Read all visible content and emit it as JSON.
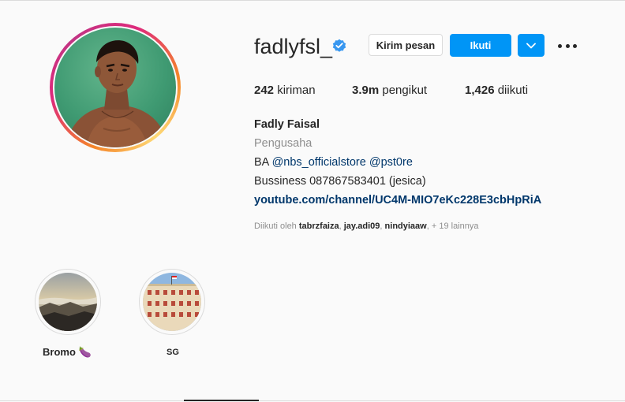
{
  "profile": {
    "username": "fadlyfsl_",
    "message_button": "Kirim pesan",
    "follow_button": "Ikuti",
    "stats": {
      "posts_value": "242",
      "posts_label": "kiriman",
      "followers_value": "3.9m",
      "followers_label": "pengikut",
      "following_value": "1,426",
      "following_label": "diikuti"
    },
    "full_name": "Fadly Faisal",
    "category": "Pengusaha",
    "bio_ba": "BA",
    "bio_mention_1": "@nbs_officialstore",
    "bio_mention_2": "@pst0re",
    "bio_line2": "Bussiness 087867583401 (jesica)",
    "link": "youtube.com/channel/UC4M-MIO7eKc228E3cbHpRiA",
    "followed_by_prefix": "Diikuti oleh",
    "followed_by_users": [
      "tabrzfaiza",
      "jay.adi09",
      "nindyiaaw"
    ],
    "followed_by_suffix": "+ 19 lainnya"
  },
  "highlights": [
    {
      "label": "Bromo",
      "emoji": "🍆"
    },
    {
      "label": "SG"
    }
  ],
  "colors": {
    "accent": "#0095f6",
    "link": "#00376b",
    "muted": "#8e8e8e",
    "text": "#262626",
    "background": "#fafafa"
  },
  "icons": [
    "verified-badge-icon",
    "chevron-down-icon",
    "more-options-icon",
    "eggplant-emoji-icon"
  ]
}
